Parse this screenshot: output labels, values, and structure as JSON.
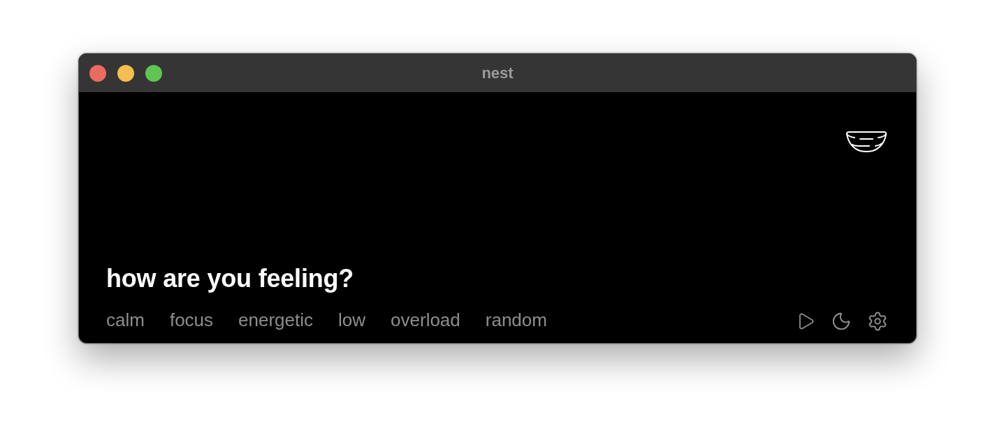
{
  "window": {
    "title": "nest"
  },
  "prompt": "how are you feeling?",
  "moods": [
    "calm",
    "focus",
    "energetic",
    "low",
    "overload",
    "random"
  ]
}
